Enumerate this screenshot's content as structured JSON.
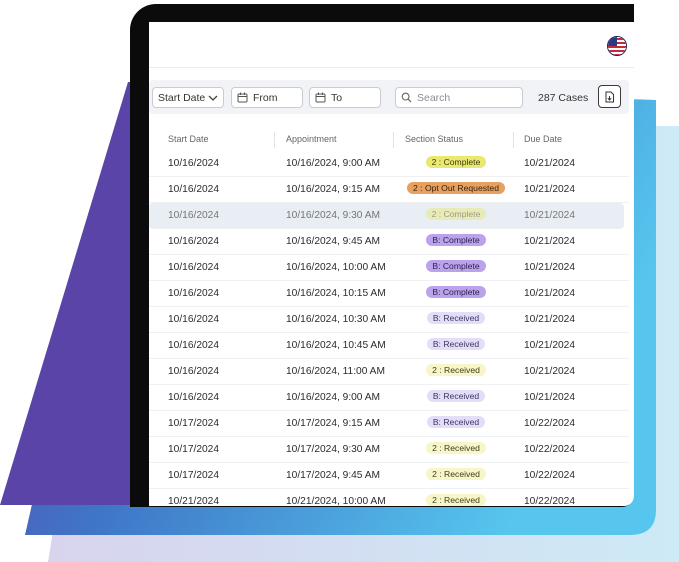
{
  "toolbar": {
    "start_date_label": "Start Date",
    "from_label": "From",
    "to_label": "To",
    "search_placeholder": "Search",
    "case_count": "287 Cases"
  },
  "table": {
    "columns": [
      "Start Date",
      "Appointment",
      "Section Status",
      "Due Date"
    ],
    "rows": [
      {
        "start": "10/16/2024",
        "appt": "10/16/2024, 9:00 AM",
        "status": "2 : Complete",
        "status_kind": "yellow",
        "due": "10/21/2024",
        "highlighted": false
      },
      {
        "start": "10/16/2024",
        "appt": "10/16/2024, 9:15 AM",
        "status": "2 : Opt Out Requested",
        "status_kind": "orange",
        "due": "10/21/2024",
        "highlighted": false
      },
      {
        "start": "10/16/2024",
        "appt": "10/16/2024, 9:30 AM",
        "status": "2 : Complete",
        "status_kind": "yellow",
        "due": "10/21/2024",
        "highlighted": true
      },
      {
        "start": "10/16/2024",
        "appt": "10/16/2024, 9:45 AM",
        "status": "B: Complete",
        "status_kind": "purple",
        "due": "10/21/2024",
        "highlighted": false
      },
      {
        "start": "10/16/2024",
        "appt": "10/16/2024, 10:00 AM",
        "status": "B: Complete",
        "status_kind": "purple",
        "due": "10/21/2024",
        "highlighted": false
      },
      {
        "start": "10/16/2024",
        "appt": "10/16/2024, 10:15 AM",
        "status": "B: Complete",
        "status_kind": "purple",
        "due": "10/21/2024",
        "highlighted": false
      },
      {
        "start": "10/16/2024",
        "appt": "10/16/2024, 10:30 AM",
        "status": "B: Received",
        "status_kind": "lavender",
        "due": "10/21/2024",
        "highlighted": false
      },
      {
        "start": "10/16/2024",
        "appt": "10/16/2024, 10:45 AM",
        "status": "B: Received",
        "status_kind": "lavender",
        "due": "10/21/2024",
        "highlighted": false
      },
      {
        "start": "10/16/2024",
        "appt": "10/16/2024, 11:00 AM",
        "status": "2 : Received",
        "status_kind": "pale-yellow",
        "due": "10/21/2024",
        "highlighted": false
      },
      {
        "start": "10/16/2024",
        "appt": "10/16/2024, 9:00 AM",
        "status": "B: Received",
        "status_kind": "lavender",
        "due": "10/21/2024",
        "highlighted": false
      },
      {
        "start": "10/17/2024",
        "appt": "10/17/2024, 9:15 AM",
        "status": "B: Received",
        "status_kind": "lavender",
        "due": "10/22/2024",
        "highlighted": false
      },
      {
        "start": "10/17/2024",
        "appt": "10/17/2024, 9:30 AM",
        "status": "2 : Received",
        "status_kind": "pale-yellow",
        "due": "10/22/2024",
        "highlighted": false
      },
      {
        "start": "10/17/2024",
        "appt": "10/17/2024, 9:45 AM",
        "status": "2 : Received",
        "status_kind": "pale-yellow",
        "due": "10/22/2024",
        "highlighted": false
      },
      {
        "start": "10/21/2024",
        "appt": "10/21/2024, 10:00 AM",
        "status": "2 : Received",
        "status_kind": "pale-yellow",
        "due": "10/22/2024",
        "highlighted": false
      }
    ]
  },
  "status_colors": {
    "yellow": {
      "bg": "#e9e86f",
      "fg": "#3d3a10"
    },
    "orange": {
      "bg": "#e6a060",
      "fg": "#3a230e"
    },
    "purple": {
      "bg": "#bba3ec",
      "fg": "#2e2250"
    },
    "lavender": {
      "bg": "#e3ddf8",
      "fg": "#3d3660"
    },
    "pale-yellow": {
      "bg": "#f6f6c8",
      "fg": "#3f3d1c"
    }
  },
  "icons": {
    "start_date": "chevron-down-icon",
    "from": "calendar-icon",
    "to": "calendar-icon",
    "search": "search-icon",
    "export": "file-export-icon",
    "locale": "us-flag-icon"
  },
  "colors": {
    "device_frame": "#0b0b0b",
    "toolbar_bg": "#f1f3f6",
    "highlight_row": "#e9eef5"
  }
}
